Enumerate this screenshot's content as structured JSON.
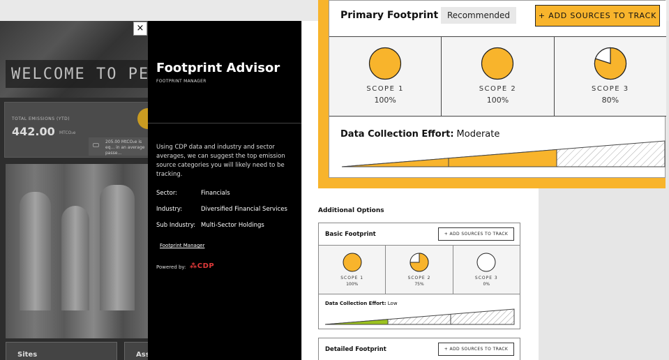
{
  "background": {
    "hero_title": "WELCOME TO PER",
    "total_label": "TOTAL EMISSIONS (YTD)",
    "total_value": "442.00",
    "total_unit": "MTCO₂e",
    "note_text": "205.00 MtCO₂e is eq... in an average passe...",
    "sites_label": "Sites",
    "assets_label": "Ass"
  },
  "advisor": {
    "close_label": "×",
    "title": "Footprint Advisor",
    "subtitle": "FOOTPRINT MANAGER",
    "description": "Using CDP data and industry and sector averages, we can suggest the top emission source categories you will likely need to be tracking.",
    "sector_label": "Sector:",
    "sector_value": "Financials",
    "industry_label": "Industry:",
    "industry_value": "Diversified Financial Services",
    "subindustry_label": "Sub Industry:",
    "subindustry_value": "Multi-Sector Holdings",
    "link_label": "Footprint Manager",
    "powered_label": "Powered by:",
    "powered_brand": "CDP"
  },
  "primary": {
    "title": "Primary Footprint",
    "badge": "Recommended",
    "add_button": "+  ADD SOURCES TO TRACK",
    "scopes": [
      {
        "name": "SCOPE 1",
        "pct": "100%",
        "fraction": 1.0
      },
      {
        "name": "SCOPE 2",
        "pct": "100%",
        "fraction": 1.0
      },
      {
        "name": "SCOPE 3",
        "pct": "80%",
        "fraction": 0.8
      }
    ],
    "effort_label": "Data Collection Effort:",
    "effort_value": "Moderate"
  },
  "additional": {
    "heading": "Additional Options",
    "basic": {
      "title": "Basic Footprint",
      "add_button": "+  ADD SOURCES TO TRACK",
      "scopes": [
        {
          "name": "SCOPE 1",
          "pct": "100%",
          "fraction": 1.0
        },
        {
          "name": "SCOPE 2",
          "pct": "75%",
          "fraction": 0.75
        },
        {
          "name": "SCOPE 3",
          "pct": "0%",
          "fraction": 0.0
        }
      ],
      "effort_label": "Data Collection Effort:",
      "effort_value": "Low"
    },
    "detailed": {
      "title": "Detailed Footprint",
      "add_button": "+  ADD SOURCES TO TRACK"
    }
  },
  "colors": {
    "accent": "#f8b42c",
    "low": "#9bc21f",
    "cdp": "#e13a3a"
  }
}
